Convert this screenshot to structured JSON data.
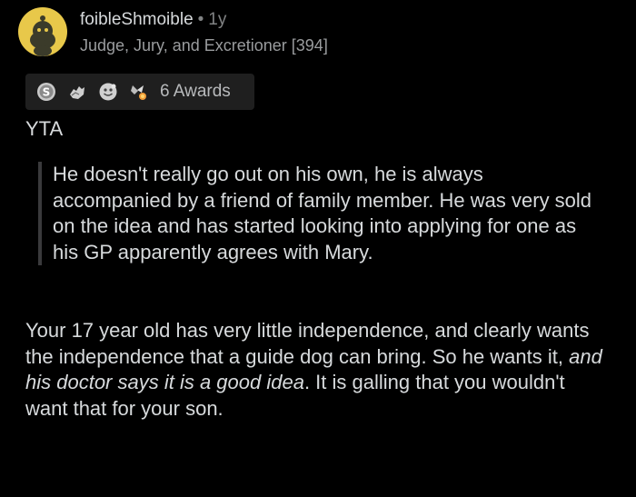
{
  "comment": {
    "username": "foibleShmoible",
    "separator": "•",
    "age": "1y",
    "flair": "Judge, Jury, and Excretioner [394]",
    "awards_label": "6 Awards",
    "paragraphs": {
      "verdict": "YTA",
      "quote": "He doesn't really go out on his own, he is always accompanied by a friend of family member. He was very sold on the idea and has started looking into applying for one as his GP apparently agrees with Mary.",
      "body_start": "Your 17 year old has very little independence, and clearly wants the independence that a guide dog can bring. So he wants it, ",
      "body_italic": "and his doctor says it is a good idea",
      "body_end": ". It is galling that you wouldn't want that for your son."
    }
  },
  "icons": {
    "avatar": "snoo-avatar-icon",
    "award_1": "silver-award-icon",
    "award_2": "helpful-hand-award-icon",
    "award_3": "wholesome-award-icon",
    "award_4": "rocket-like-award-icon"
  },
  "colors": {
    "background": "#000000",
    "text": "#d7dadc",
    "muted": "#818384",
    "avatar": "#e8c84a",
    "awards_bg": "#1f1f1f",
    "quote_bar": "#3a3a3c"
  }
}
